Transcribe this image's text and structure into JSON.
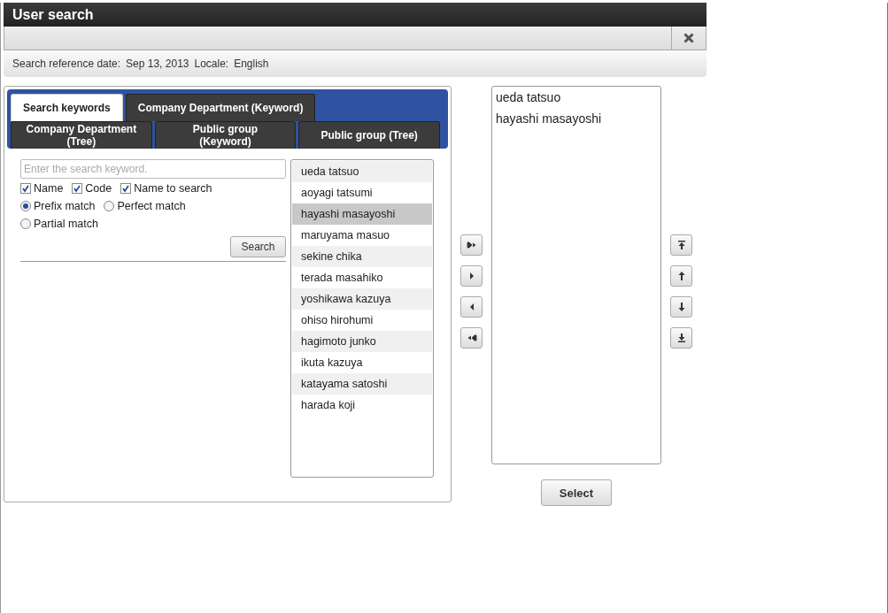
{
  "window": {
    "title": "User search"
  },
  "info": [
    {
      "label": "Search reference date:",
      "value": "Sep 13, 2013"
    },
    {
      "label": "Locale:",
      "value": "English"
    }
  ],
  "tab_rows": [
    [
      {
        "label": "Search keywords",
        "selected": true
      },
      {
        "label": "Company Department (Keyword)",
        "selected": false
      }
    ],
    [
      {
        "label": "Company Department (Tree)",
        "selected": false
      },
      {
        "label": "Public group (Keyword)",
        "selected": false
      },
      {
        "label": "Public group (Tree)",
        "selected": false
      }
    ]
  ],
  "search": {
    "placeholder": "Enter the search keyword.",
    "button": "Search"
  },
  "checkboxes": [
    {
      "label": "Name",
      "checked": true
    },
    {
      "label": "Code",
      "checked": true
    },
    {
      "label": "Name to search",
      "checked": true
    }
  ],
  "radios": [
    {
      "label": "Prefix match",
      "selected": true
    },
    {
      "label": "Perfect match",
      "selected": false
    },
    {
      "label": "Partial match",
      "selected": false
    }
  ],
  "results": [
    {
      "name": "ueda tatsuo",
      "selected": false
    },
    {
      "name": "aoyagi tatsumi",
      "selected": false
    },
    {
      "name": "hayashi masayoshi",
      "selected": true
    },
    {
      "name": "maruyama masuo",
      "selected": false
    },
    {
      "name": "sekine chika",
      "selected": false
    },
    {
      "name": "terada masahiko",
      "selected": false
    },
    {
      "name": "yoshikawa kazuya",
      "selected": false
    },
    {
      "name": "ohiso hirohumi",
      "selected": false
    },
    {
      "name": "hagimoto junko",
      "selected": false
    },
    {
      "name": "ikuta kazuya",
      "selected": false
    },
    {
      "name": "katayama satoshi",
      "selected": false
    },
    {
      "name": "harada koji",
      "selected": false
    }
  ],
  "transfer_buttons": [
    {
      "kind": "add-all"
    },
    {
      "kind": "add"
    },
    {
      "kind": "remove"
    },
    {
      "kind": "remove-all"
    }
  ],
  "chosen": [
    "ueda tatsuo",
    "hayashi masayoshi"
  ],
  "order_buttons": [
    {
      "kind": "top"
    },
    {
      "kind": "up"
    },
    {
      "kind": "down"
    },
    {
      "kind": "bottom"
    }
  ],
  "select_button": "Select"
}
